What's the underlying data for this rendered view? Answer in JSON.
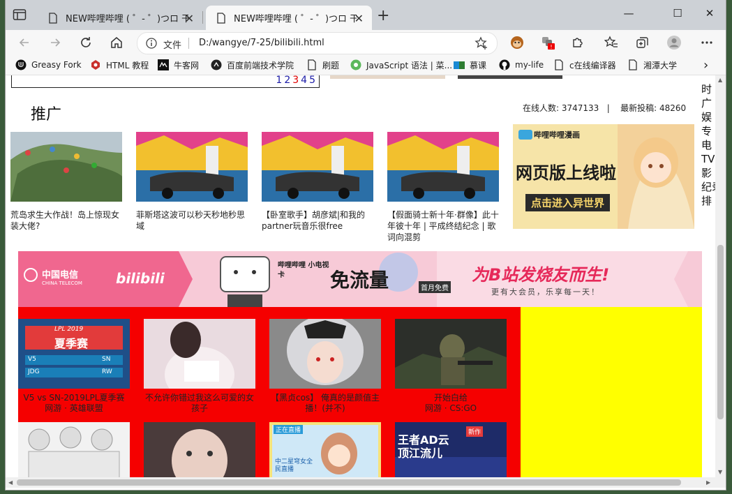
{
  "browser": {
    "tabs": [
      {
        "title": "NEW哔哩哔哩 ( ゜- ゜)つロ 干杯~",
        "active": false
      },
      {
        "title": "NEW哔哩哔哩 ( ゜- ゜)つロ 干杯~",
        "active": true
      }
    ],
    "new_tab": "+",
    "window_controls": {
      "minimize": "—",
      "maximize": "☐",
      "close": "✕"
    },
    "address": {
      "label": "文件",
      "url": "D:/wangye/7-25/bilibili.html"
    },
    "bookmarks": [
      "Greasy Fork",
      "HTML 教程",
      "牛客网",
      "百度前端技术学院",
      "刷题",
      "JavaScript 语法 | 菜...",
      "慕课",
      "my-life",
      "c在线编译器",
      "湘潭大学"
    ],
    "bookmarks_more": "›"
  },
  "page": {
    "pager_numbers": [
      "1",
      "2",
      "3",
      "4",
      "5"
    ],
    "section_title": "推广",
    "online_label": "在线人数:",
    "online_count": "3747133",
    "stat_sep": "|",
    "new_posts_label": "最新投稿:",
    "new_posts_count": "48260",
    "promo_cards": [
      {
        "caption": "荒岛求生大作战！岛上惊现女装大佬?"
      },
      {
        "caption": "菲斯塔这波可以秒天秒地秒思域"
      },
      {
        "caption": "【卧室歌手】胡彦斌|和我的partner玩音乐很free"
      },
      {
        "caption": "【假面骑士新十年·群像】此十年彼十年 | 平成终结纪念 | 歌词向混剪"
      }
    ],
    "comic_banner": {
      "brand": "哔哩哔哩漫画",
      "headline": "网页版上线啦",
      "button": "点击进入异世界"
    },
    "right_column_chars": [
      "时",
      "广",
      "娱",
      "专",
      "电",
      "TV",
      "影",
      "纪录",
      "排"
    ],
    "promo_banner": {
      "telecom": "中国电信",
      "telecom_en": "CHINA TELECOM",
      "bili": "bilibili",
      "card_label": "哔哩哔哩 小电视卡",
      "free": "免流量",
      "first_month": "首月免费",
      "slogan": "为B站发烧友而生!",
      "slogan_sub": "更有大会员，乐享每一天！"
    },
    "video_cards": [
      {
        "title": "V5 vs SN-2019LPL夏季赛",
        "sub": "网游 · 英雄联盟"
      },
      {
        "title": "不允许你错过我这么可爱的女孩子",
        "sub": ""
      },
      {
        "title": "【黑贞cos】 俺真的是颜值主播！(并不)",
        "sub": ""
      },
      {
        "title": "开始白给",
        "sub": "网游 · CS:GO"
      }
    ],
    "lpl_thumb": {
      "title": "LPL 2019",
      "season": "夏季赛",
      "rows": [
        [
          "V5",
          "SN"
        ],
        [
          "JDG",
          "RW"
        ]
      ]
    },
    "live_badge": "正在直播",
    "live_text": "中二星穹女全民直播",
    "wangzhe_text": "王者AD云顶江流儿",
    "new_badge": "新作"
  },
  "colors": {
    "red_block": "#f50000",
    "yellow_block": "#ffff00",
    "promo_pink": "#f0678f"
  }
}
